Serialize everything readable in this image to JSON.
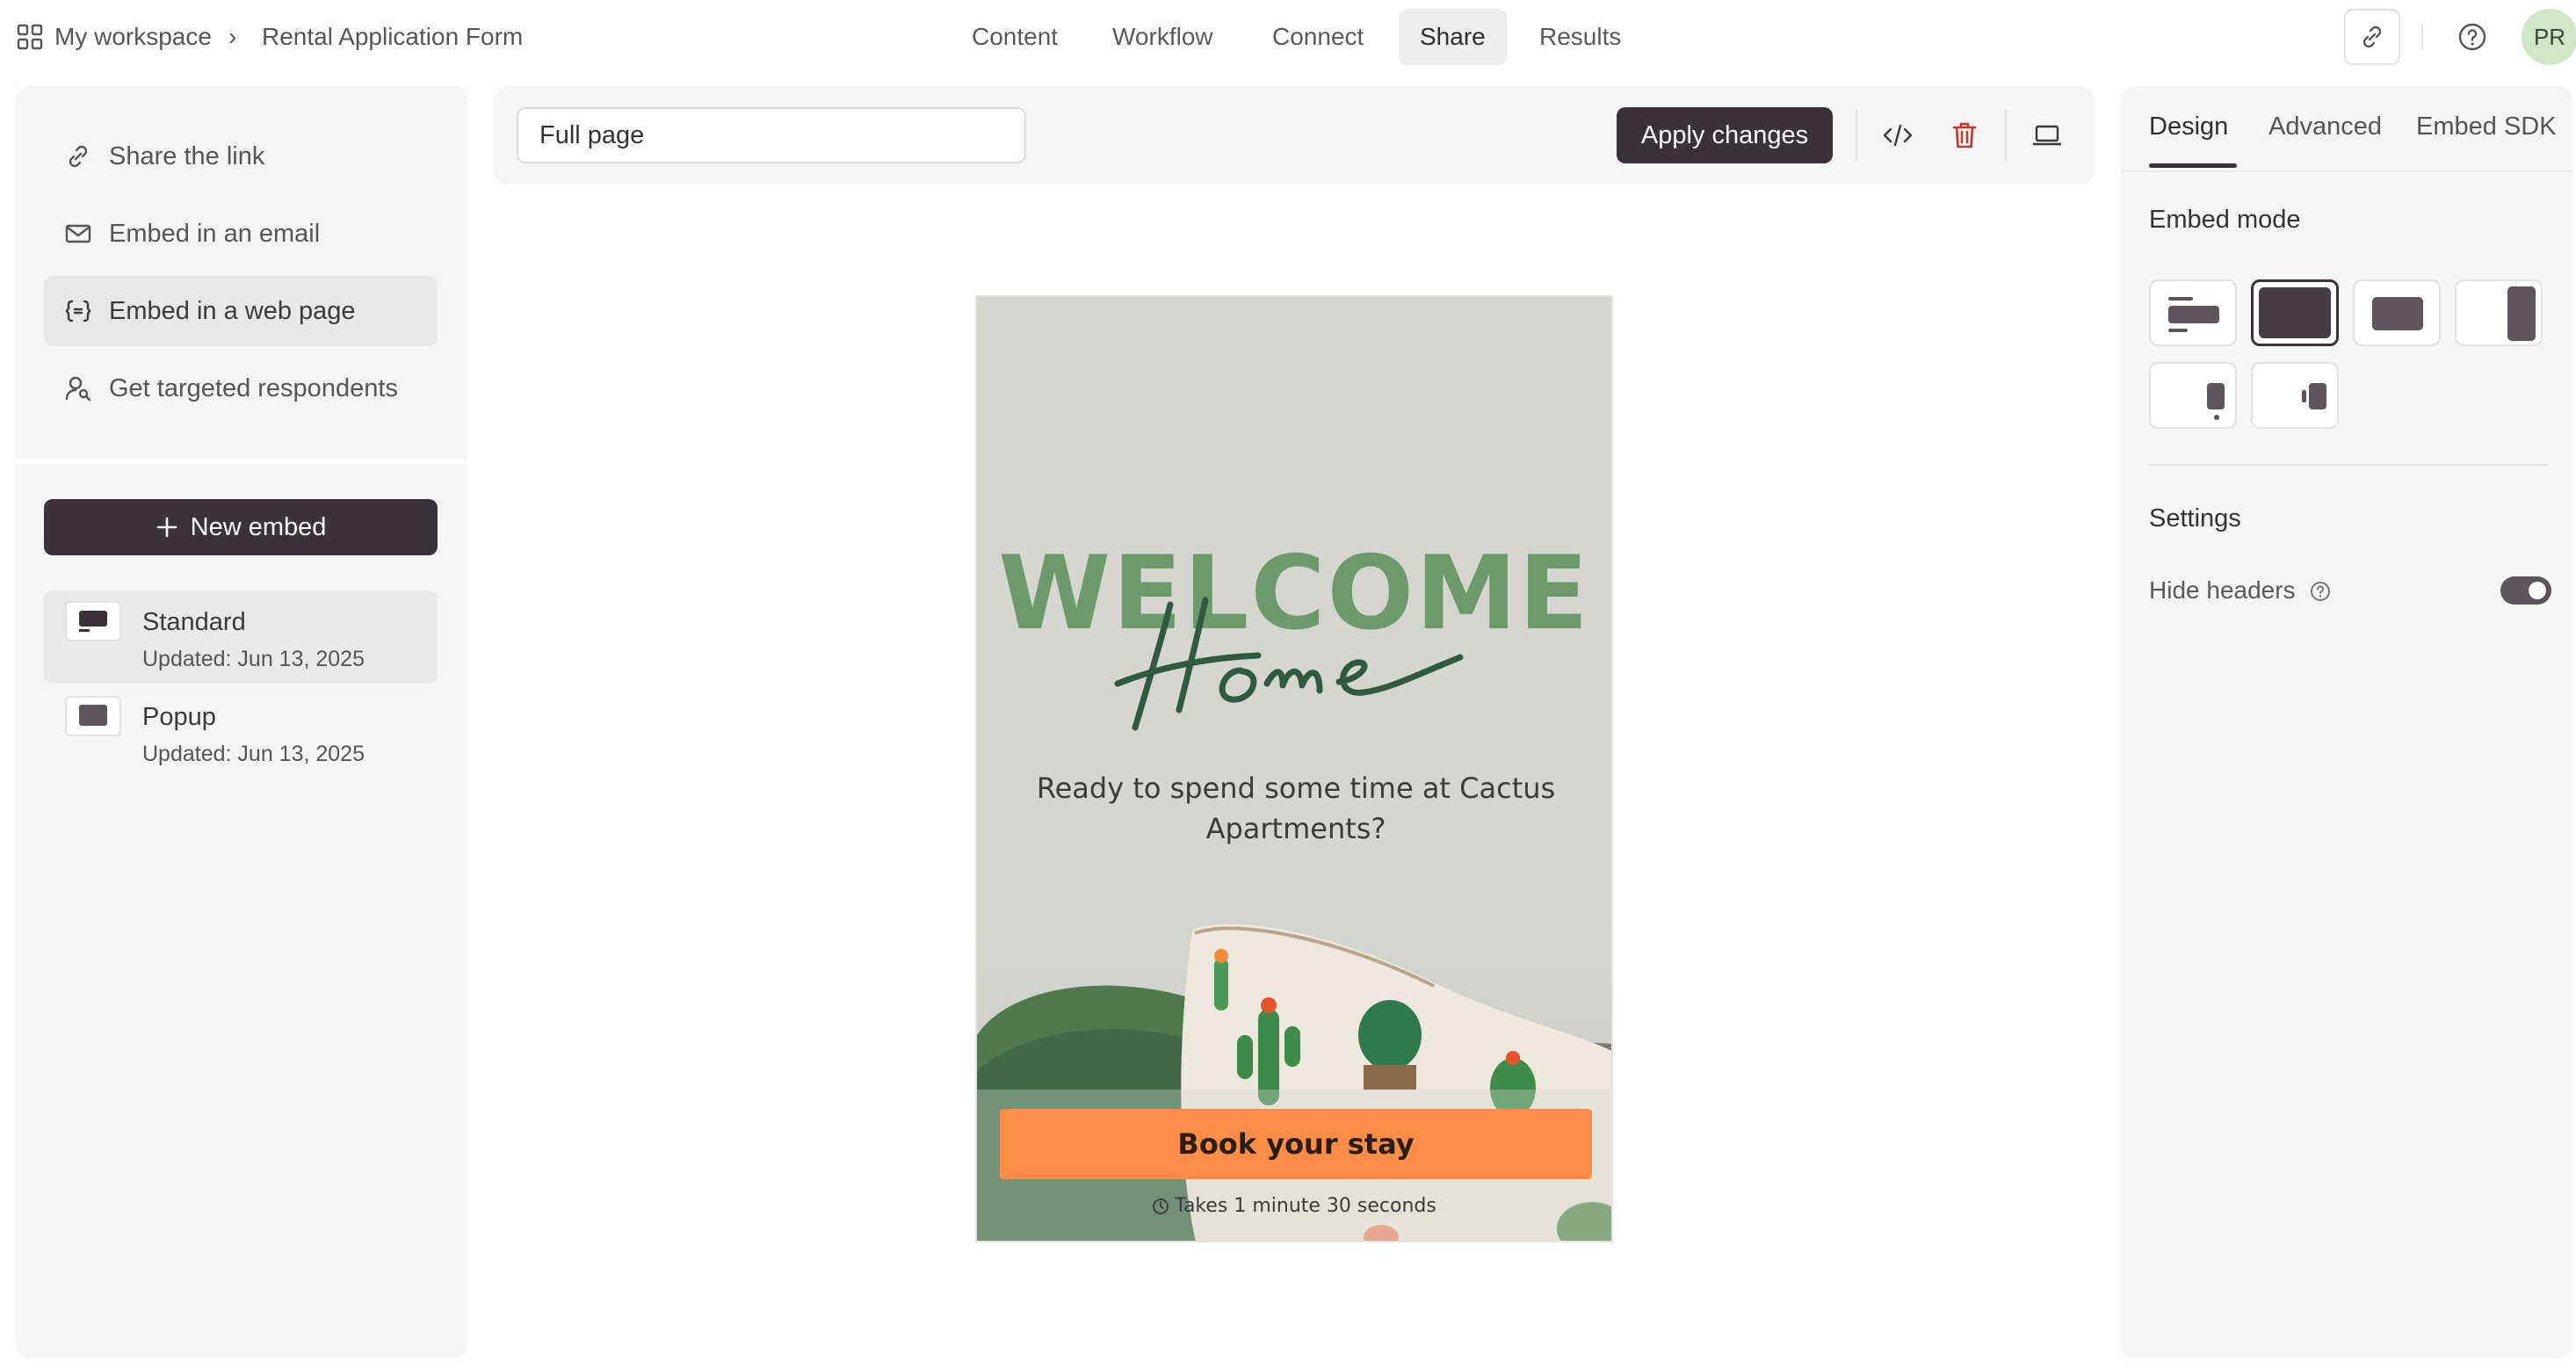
{
  "breadcrumb": {
    "workspace": "My workspace",
    "separator": "›",
    "form": "Rental Application Form"
  },
  "top_nav": [
    "Content",
    "Workflow",
    "Connect",
    "Share",
    "Results"
  ],
  "top_nav_active": "Share",
  "user": {
    "initials": "PR"
  },
  "share_options": [
    {
      "label": "Share the link",
      "icon": "link-icon"
    },
    {
      "label": "Embed in an email",
      "icon": "mail-icon"
    },
    {
      "label": "Embed in a web page",
      "icon": "code-braces-icon",
      "active": true
    },
    {
      "label": "Get targeted respondents",
      "icon": "user-search-icon"
    }
  ],
  "new_embed_label": "New embed",
  "embeds": [
    {
      "name": "Standard",
      "updated": "Updated: Jun 13, 2025",
      "active": true
    },
    {
      "name": "Popup",
      "updated": "Updated: Jun 13, 2025"
    }
  ],
  "toolbar": {
    "preset": "Full page",
    "apply_label": "Apply changes"
  },
  "preview": {
    "welcome": "WELCOME",
    "script_word": "Home",
    "subtitle": "Ready to spend some time at Cactus Apartments?",
    "cta": "Book your stay",
    "duration": "Takes 1 minute 30 seconds"
  },
  "right_tabs": [
    "Design",
    "Advanced",
    "Embed SDK"
  ],
  "right_tab_active": "Design",
  "embed_mode_label": "Embed mode",
  "embed_modes": [
    "standard",
    "full-page",
    "popup",
    "slider",
    "popover",
    "side-tab"
  ],
  "embed_mode_active": "full-page",
  "settings_label": "Settings",
  "hide_headers": {
    "label": "Hide headers",
    "enabled": true
  },
  "colors": {
    "primary": "#3b3138",
    "cta": "#ff8d47",
    "welcome_green": "#6c9a6c",
    "script_green": "#2f5a3e",
    "avatar_bg": "#cfe6c7"
  }
}
